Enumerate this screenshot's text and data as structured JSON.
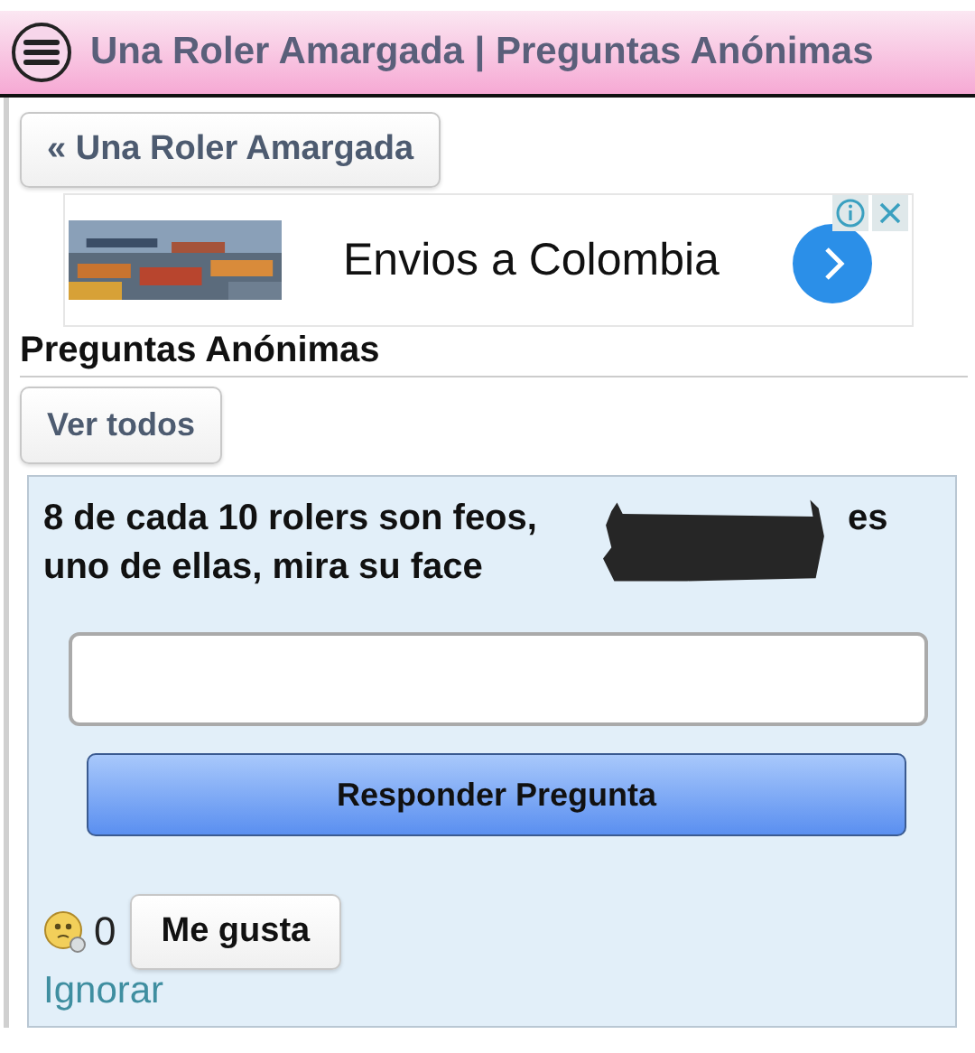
{
  "header": {
    "title": "Una Roler Amargada | Preguntas Anónimas"
  },
  "back_button": "« Una Roler Amargada",
  "ad": {
    "text": "Envios a Colombia"
  },
  "section_title": "Preguntas Anónimas",
  "view_all_button": "Ver todos",
  "question": {
    "line_1": "8 de cada 10 rolers son feos,",
    "line_1_end": "es",
    "line_2": "uno de ellas, mira su face",
    "redacted": true
  },
  "answer_button": "Responder Pregunta",
  "likes": {
    "count": "0",
    "button": "Me gusta"
  },
  "ignore_link": "Ignorar"
}
